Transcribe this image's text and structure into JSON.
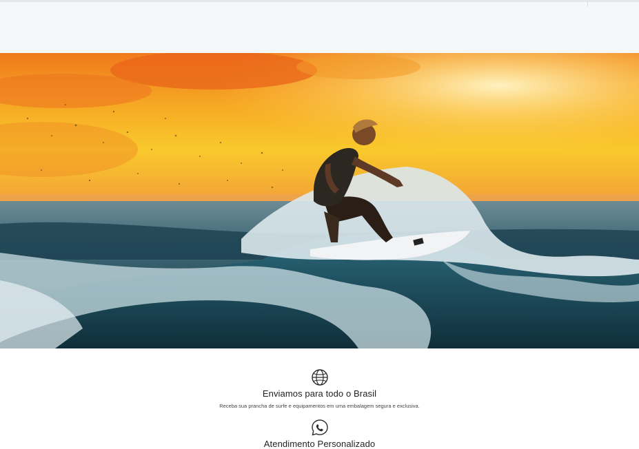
{
  "hero": {
    "image_alt": "surfer-riding-wave-at-sunset"
  },
  "features": [
    {
      "icon": "globe-icon",
      "title": "Enviamos para todo o Brasil",
      "description": "Receba sua prancha de surfe e equipamentos em uma embalagem segura e exclusiva."
    },
    {
      "icon": "whatsapp-icon",
      "title": "Atendimento Personalizado",
      "description": ""
    }
  ],
  "colors": {
    "sky_top": "#f0831c",
    "sky_mid": "#f7c52a",
    "water": "#1f4b5e",
    "foam": "#d9e8ee",
    "topbar": "#f6f7f9"
  }
}
